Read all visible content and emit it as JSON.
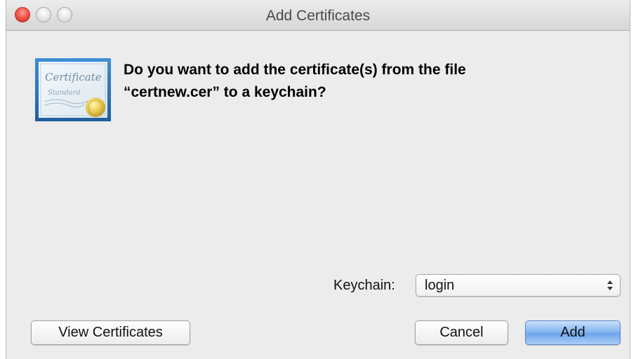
{
  "window": {
    "title": "Add Certificates"
  },
  "icon": {
    "name": "certificate-icon",
    "text_line1": "Certificate",
    "text_line2": "Standard"
  },
  "prompt": {
    "line1": "Do you want to add the certificate(s) from the file",
    "line2": "“certnew.cer” to a keychain?"
  },
  "keychain": {
    "label": "Keychain:",
    "selected": "login"
  },
  "buttons": {
    "view_certificates": "View Certificates",
    "cancel": "Cancel",
    "add": "Add"
  },
  "colors": {
    "window_bg": "#ececec",
    "default_button": "#7fb2f0",
    "close_button": "#ee4b40"
  }
}
